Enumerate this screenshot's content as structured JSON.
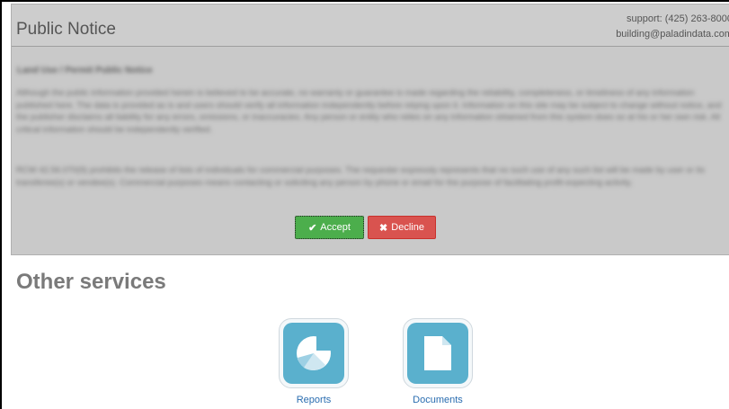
{
  "notice": {
    "title": "Public Notice",
    "support_phone": "support: (425) 263-8000",
    "support_email": "building@paladindata.com",
    "heading": "Land Use / Permit Public Notice",
    "paragraph1": "Although the public information provided herein is believed to be accurate, no warranty or guarantee is made regarding the reliability, completeness, or timeliness of any information published here. The data is provided as is and users should verify all information independently before relying upon it. Information on this site may be subject to change without notice, and the publisher disclaims all liability for any errors, omissions, or inaccuracies. Any person or entity who relies on any information obtained from this system does so at his or her own risk. All critical information should be independently verified.",
    "paragraph2": "RCW 42.56.070(9) prohibits the release of lists of individuals for commercial purposes. The requester expressly represents that no such use of any such list will be made by user or its transferee(s) or vendee(s). Commercial purposes means contacting or soliciting any person by phone or email for the purpose of facilitating profit-expecting activity.",
    "accept_label": "Accept",
    "decline_label": "Decline"
  },
  "services": {
    "title": "Other services",
    "items": [
      {
        "label": "Reports",
        "icon": "pie-chart-icon"
      },
      {
        "label": "Documents",
        "icon": "document-icon"
      }
    ]
  },
  "colors": {
    "accept": "#4cae4c",
    "decline": "#d9534f",
    "tile": "#5ab0cd",
    "link": "#2a6db0"
  }
}
